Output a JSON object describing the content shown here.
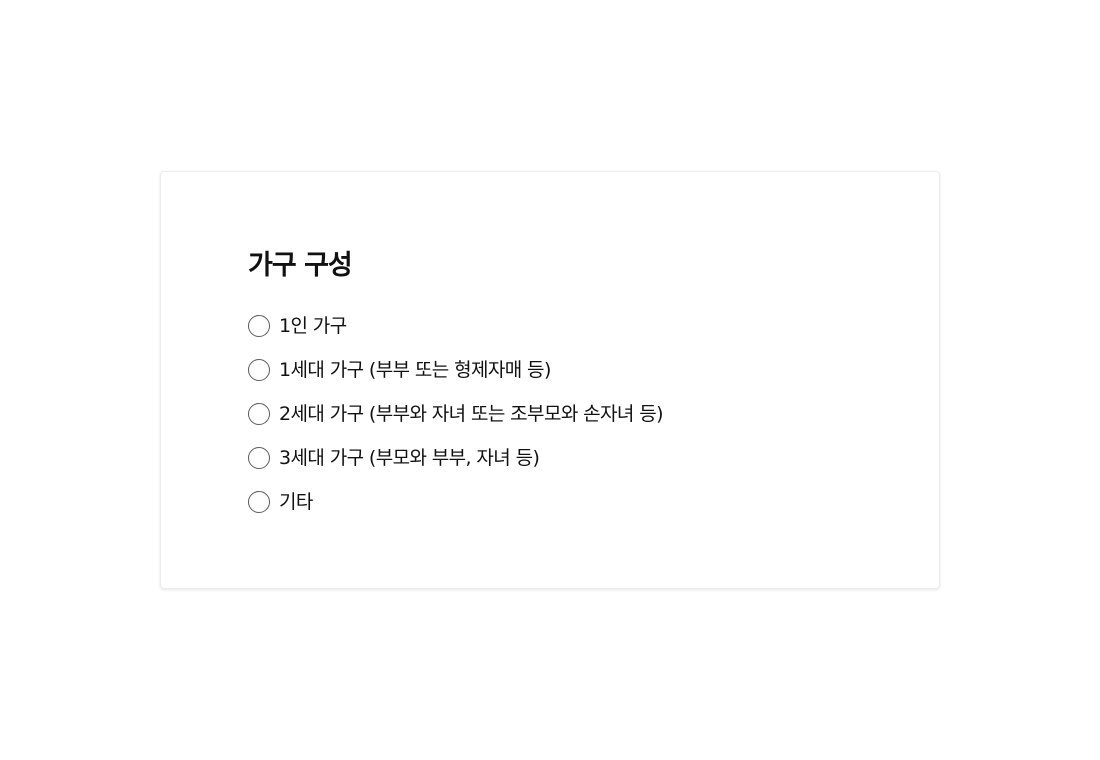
{
  "question": {
    "title": "가구 구성",
    "options": [
      {
        "label": "1인 가구",
        "selected": false
      },
      {
        "label": "1세대 가구 (부부 또는 형제자매 등)",
        "selected": false
      },
      {
        "label": "2세대 가구 (부부와 자녀 또는 조부모와 손자녀 등)",
        "selected": false
      },
      {
        "label": "3세대 가구 (부모와 부부, 자녀 등)",
        "selected": false
      },
      {
        "label": "기타",
        "selected": false
      }
    ]
  }
}
